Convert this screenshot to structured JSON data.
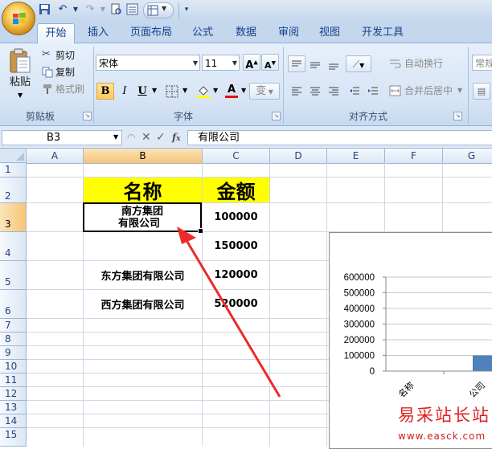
{
  "quick_access": {
    "icons": [
      "save-icon",
      "undo-icon",
      "redo-icon",
      "print-preview-icon",
      "form-icon",
      "dropdown-icon"
    ]
  },
  "tabs": [
    "开始",
    "插入",
    "页面布局",
    "公式",
    "数据",
    "审阅",
    "视图",
    "开发工具"
  ],
  "ribbon": {
    "clipboard": {
      "paste_label": "粘贴",
      "cut_label": "剪切",
      "copy_label": "复制",
      "format_painter_label": "格式刷",
      "group_label": "剪贴板"
    },
    "font": {
      "font_name": "宋体",
      "font_size": "11",
      "bold": "B",
      "italic": "I",
      "underline": "U",
      "font_color_glyph": "A",
      "phonetic_glyph": "变",
      "group_label": "字体",
      "font_color": "#e81010",
      "fill_color": "#ffff00"
    },
    "alignment": {
      "wrap_text_label": "自动换行",
      "merge_center_label": "合并后居中",
      "group_label": "对齐方式"
    },
    "number": {
      "format_label": "常规"
    }
  },
  "formula_bar": {
    "name_box": "B3",
    "formula": "有限公司"
  },
  "sheet": {
    "columns": [
      "A",
      "B",
      "C",
      "D",
      "E",
      "F",
      "G"
    ],
    "rows": [
      "1",
      "2",
      "3",
      "4",
      "5",
      "6",
      "7",
      "8",
      "9",
      "10",
      "11",
      "12",
      "13",
      "14",
      "15"
    ],
    "header_name": "名称",
    "header_amount": "金额",
    "data": [
      {
        "name_line1": "南方集团",
        "name_line2": "有限公司",
        "amount": "100000"
      },
      {
        "name_line1": "",
        "name_line2": "",
        "amount": "150000"
      },
      {
        "name_line1": "东方集团有限公司",
        "name_line2": "",
        "amount": "120000"
      },
      {
        "name_line1": "西方集团有限公司",
        "name_line2": "",
        "amount": "520000"
      }
    ],
    "header_fill": "#ffff00",
    "selection_accent": "#f6c577"
  },
  "chart_data": {
    "type": "bar",
    "title": "",
    "xlabel": "",
    "ylabel": "",
    "ylim": [
      0,
      600000
    ],
    "yticks": [
      "600000",
      "500000",
      "400000",
      "300000",
      "200000",
      "100000",
      "0"
    ],
    "categories": [
      "名称",
      "公司"
    ],
    "values": [
      0,
      100000
    ],
    "bar_color": "#4f81bd"
  },
  "watermark": {
    "title": "易采站长站",
    "url": "www.easck.com"
  }
}
